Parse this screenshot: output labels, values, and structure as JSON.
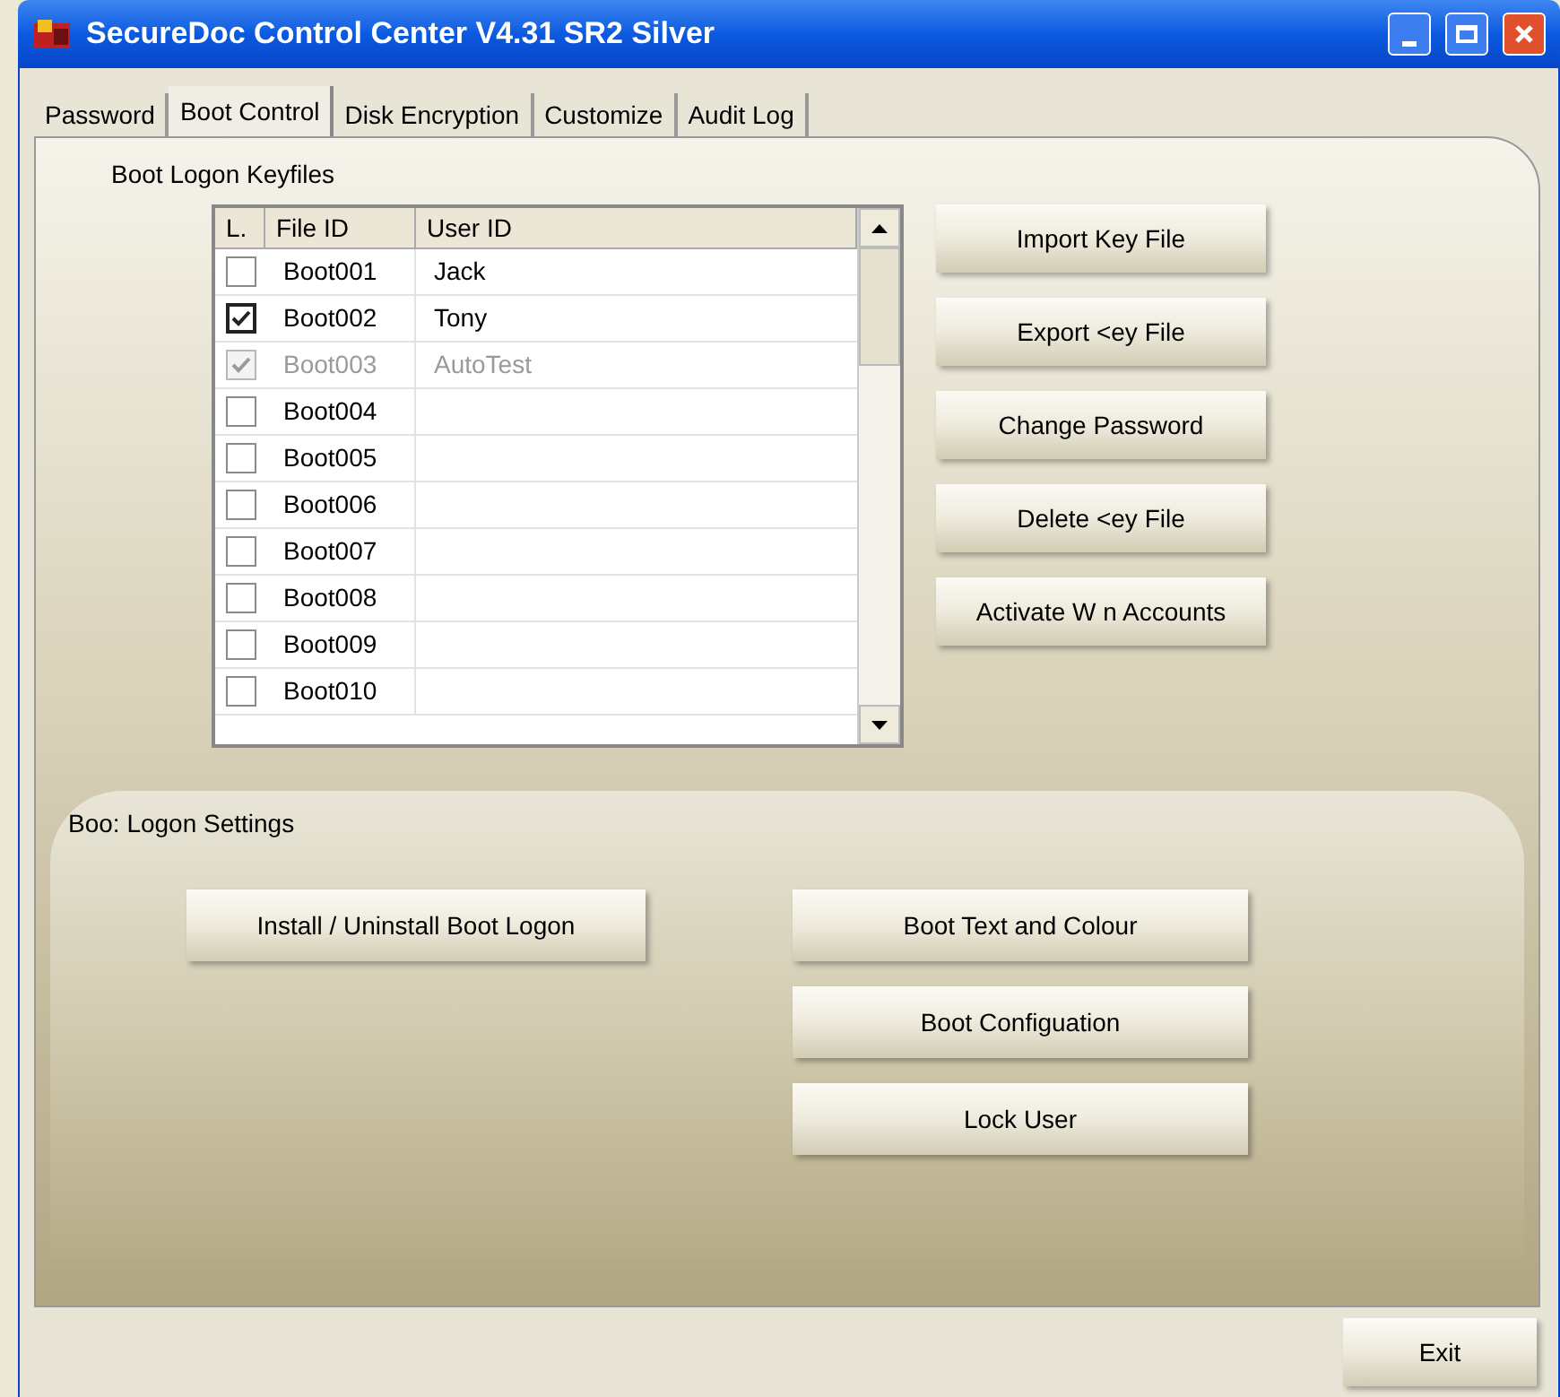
{
  "window": {
    "title": "SecureDoc Control Center V4.31 SR2 Silver"
  },
  "tabs": [
    {
      "label": "Password",
      "selected": false
    },
    {
      "label": "Boot Control",
      "selected": true
    },
    {
      "label": "Disk Encryption",
      "selected": false
    },
    {
      "label": "Customize",
      "selected": false
    },
    {
      "label": "Audit Log",
      "selected": false
    }
  ],
  "keyfiles": {
    "title": "Boot Logon Keyfiles",
    "columns": [
      "L.",
      "File ID",
      "User ID"
    ],
    "rows": [
      {
        "file_id": "Boot001",
        "user_id": "Jack",
        "checked": false,
        "disabled": false
      },
      {
        "file_id": "Boot002",
        "user_id": "Tony",
        "checked": true,
        "disabled": false
      },
      {
        "file_id": "Boot003",
        "user_id": "AutoTest",
        "checked": true,
        "disabled": true
      },
      {
        "file_id": "Boot004",
        "checked": false,
        "disabled": false
      },
      {
        "file_id": "Boot005",
        "checked": false,
        "disabled": false
      },
      {
        "file_id": "Boot006",
        "checked": false,
        "disabled": false
      },
      {
        "file_id": "Boot007",
        "checked": false,
        "disabled": false
      },
      {
        "file_id": "Boot008",
        "checked": false,
        "disabled": false
      },
      {
        "file_id": "Boot009",
        "checked": false,
        "disabled": false
      },
      {
        "file_id": "Boot010",
        "checked": false,
        "disabled": false
      }
    ],
    "buttons": [
      "Import Key File",
      "Export <ey File",
      "Change Password",
      "Delete <ey File",
      "Activate W n Accounts"
    ]
  },
  "settings": {
    "title": "Boo: Logon Settings",
    "left_buttons": [
      "Install / Uninstall  Boot Logon"
    ],
    "right_buttons": [
      "Boot Text and Colour",
      "Boot Configuation",
      "Lock User"
    ]
  },
  "footer_buttons": [
    "Exit"
  ]
}
